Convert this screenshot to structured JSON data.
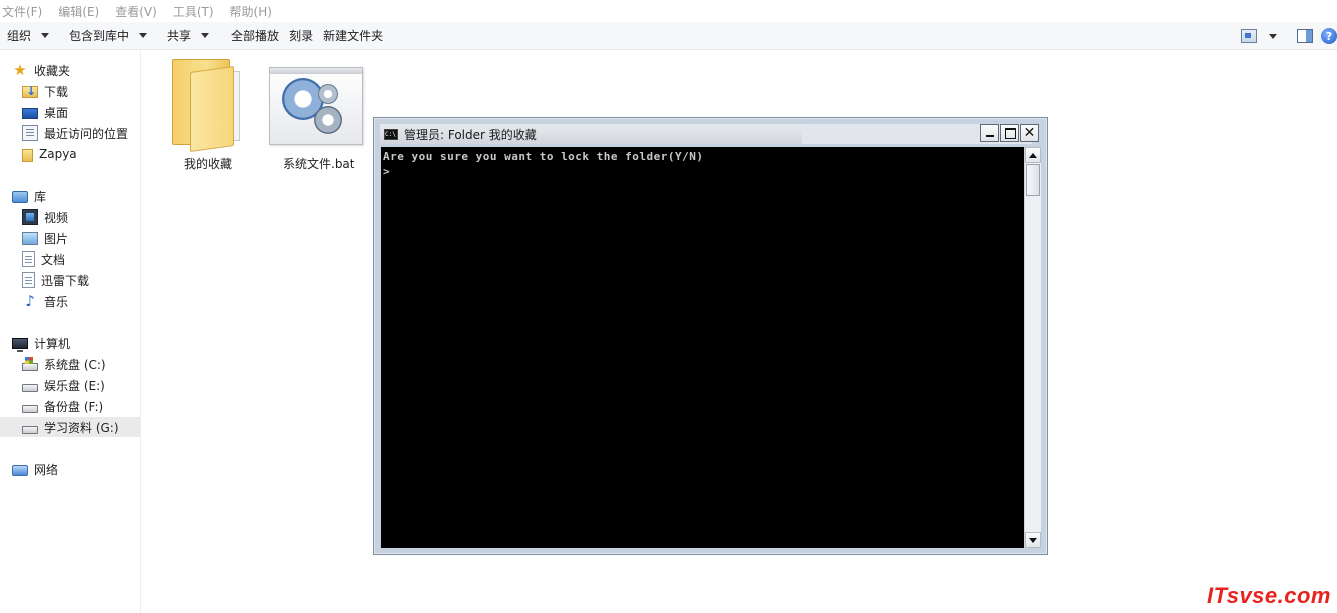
{
  "menu": [
    "文件(F)",
    "编辑(E)",
    "查看(V)",
    "工具(T)",
    "帮助(H)"
  ],
  "toolbar": {
    "organize": "组织",
    "include_library": "包含到库中",
    "share": "共享",
    "play_all": "全部播放",
    "burn": "刻录",
    "new_folder": "新建文件夹",
    "help_glyph": "?"
  },
  "nav": {
    "favorites": {
      "label": "收藏夹",
      "items": [
        "下载",
        "桌面",
        "最近访问的位置",
        "Zapya"
      ]
    },
    "libraries": {
      "label": "库",
      "items": [
        "视频",
        "图片",
        "文档",
        "迅雷下载",
        "音乐"
      ]
    },
    "computer": {
      "label": "计算机",
      "items": [
        "系统盘 (C:)",
        "娱乐盘 (E:)",
        "备份盘 (F:)",
        "学习资料 (G:)"
      ],
      "selected_index": 3
    },
    "network": {
      "label": "网络"
    }
  },
  "files": [
    {
      "name": "我的收藏",
      "type": "folder"
    },
    {
      "name": "系统文件.bat",
      "type": "batch"
    }
  ],
  "cmd_window": {
    "title": "管理员: Folder 我的收藏",
    "icon_text": "C:\\",
    "close_glyph": "✕",
    "lines": [
      "Are you sure you want to lock the folder(Y/N)",
      ">"
    ]
  },
  "watermark": "ITsvse.com",
  "colors": {
    "watermark": "#e8221c",
    "console_bg": "#000000",
    "console_text": "#c8c8c8"
  }
}
